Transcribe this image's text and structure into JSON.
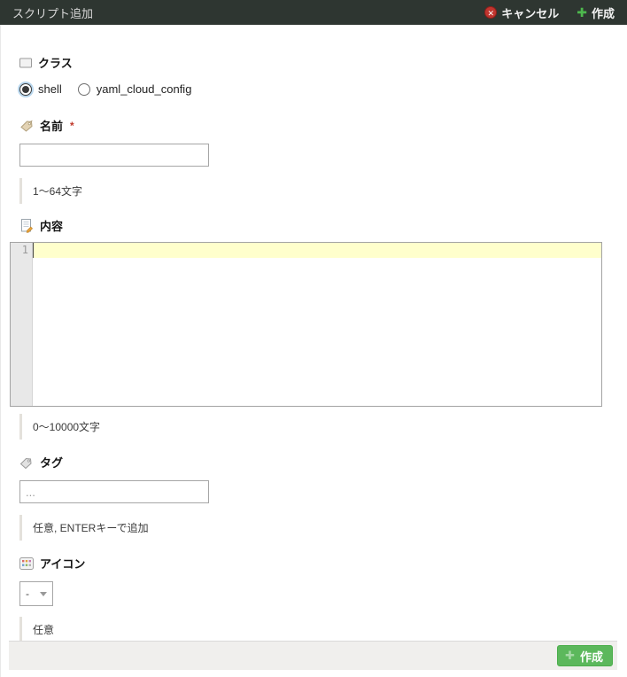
{
  "header": {
    "title": "スクリプト追加",
    "cancel_label": "キャンセル",
    "create_label": "作成"
  },
  "form": {
    "class": {
      "label": "クラス",
      "options": [
        {
          "label": "shell",
          "selected": true
        },
        {
          "label": "yaml_cloud_config",
          "selected": false
        }
      ]
    },
    "name": {
      "label": "名前",
      "required_marker": "*",
      "value": "",
      "hint": "1〜64文字"
    },
    "content": {
      "label": "内容",
      "line_number": "1",
      "value": "",
      "hint": "0〜10000文字"
    },
    "tags": {
      "label": "タグ",
      "value": "",
      "placeholder": "...",
      "hint": "任意, ENTERキーで追加"
    },
    "icon": {
      "label": "アイコン",
      "selected_value": "-",
      "hint": "任意"
    }
  },
  "footer": {
    "create_label": "作成"
  },
  "icons": {
    "header_cancel": "circle-x-icon",
    "header_create": "plus-icon",
    "class": "panel-square-icon",
    "name": "price-tag-icon",
    "content": "document-edit-icon",
    "tags": "tag-icon",
    "icon": "icon-grid-icon",
    "footer_create": "plus-icon"
  },
  "colors": {
    "header_bg": "#2e3631",
    "accent_green": "#5cb85c",
    "cancel_red": "#c1352f",
    "editor_active_line": "#ffffcc",
    "footer_bg": "#f0efed"
  }
}
